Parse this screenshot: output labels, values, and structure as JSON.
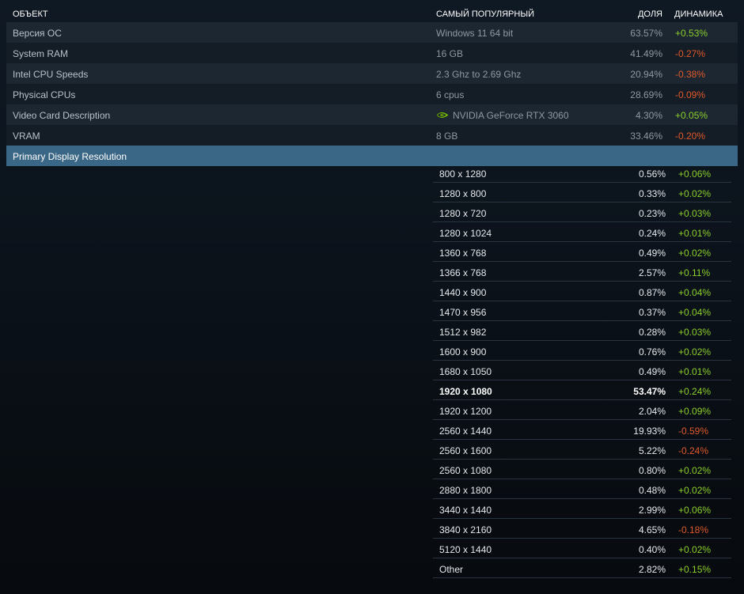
{
  "header": {
    "object": "ОБЪЕКТ",
    "most_popular": "САМЫЙ ПОПУЛЯРНЫЙ",
    "share": "ДОЛЯ",
    "change": "ДИНАМИКА"
  },
  "rows": [
    {
      "name": "Версия ОС",
      "popular": "Windows 11 64 bit",
      "share": "63.57%",
      "change": "+0.53%"
    },
    {
      "name": "System RAM",
      "popular": "16 GB",
      "share": "41.49%",
      "change": "-0.27%"
    },
    {
      "name": "Intel CPU Speeds",
      "popular": "2.3 Ghz to 2.69 Ghz",
      "share": "20.94%",
      "change": "-0.38%"
    },
    {
      "name": "Physical CPUs",
      "popular": "6 cpus",
      "share": "28.69%",
      "change": "-0.09%"
    },
    {
      "name": "Video Card Description",
      "popular": "NVIDIA GeForce RTX 3060",
      "share": "4.30%",
      "change": "+0.05%",
      "icon": "nvidia-logo-icon"
    },
    {
      "name": "VRAM",
      "popular": "8 GB",
      "share": "33.46%",
      "change": "-0.20%"
    }
  ],
  "section": {
    "title": "Primary Display Resolution"
  },
  "resolutions": [
    {
      "name": "800 x 1280",
      "share": "0.56%",
      "change": "+0.06%"
    },
    {
      "name": "1280 x 800",
      "share": "0.33%",
      "change": "+0.02%"
    },
    {
      "name": "1280 x 720",
      "share": "0.23%",
      "change": "+0.03%"
    },
    {
      "name": "1280 x 1024",
      "share": "0.24%",
      "change": "+0.01%"
    },
    {
      "name": "1360 x 768",
      "share": "0.49%",
      "change": "+0.02%"
    },
    {
      "name": "1366 x 768",
      "share": "2.57%",
      "change": "+0.11%"
    },
    {
      "name": "1440 x 900",
      "share": "0.87%",
      "change": "+0.04%"
    },
    {
      "name": "1470 x 956",
      "share": "0.37%",
      "change": "+0.04%"
    },
    {
      "name": "1512 x 982",
      "share": "0.28%",
      "change": "+0.03%"
    },
    {
      "name": "1600 x 900",
      "share": "0.76%",
      "change": "+0.02%"
    },
    {
      "name": "1680 x 1050",
      "share": "0.49%",
      "change": "+0.01%"
    },
    {
      "name": "1920 x 1080",
      "share": "53.47%",
      "change": "+0.24%",
      "bold": true
    },
    {
      "name": "1920 x 1200",
      "share": "2.04%",
      "change": "+0.09%"
    },
    {
      "name": "2560 x 1440",
      "share": "19.93%",
      "change": "-0.59%"
    },
    {
      "name": "2560 x 1600",
      "share": "5.22%",
      "change": "-0.24%"
    },
    {
      "name": "2560 x 1080",
      "share": "0.80%",
      "change": "+0.02%"
    },
    {
      "name": "2880 x 1800",
      "share": "0.48%",
      "change": "+0.02%"
    },
    {
      "name": "3440 x 1440",
      "share": "2.99%",
      "change": "+0.06%"
    },
    {
      "name": "3840 x 2160",
      "share": "4.65%",
      "change": "-0.18%"
    },
    {
      "name": "5120 x 1440",
      "share": "0.40%",
      "change": "+0.02%"
    },
    {
      "name": "Other",
      "share": "2.82%",
      "change": "+0.15%"
    }
  ],
  "colors": {
    "positive": "#8ccf2a",
    "negative": "#e0592a",
    "section_bg": "#3b6786"
  }
}
